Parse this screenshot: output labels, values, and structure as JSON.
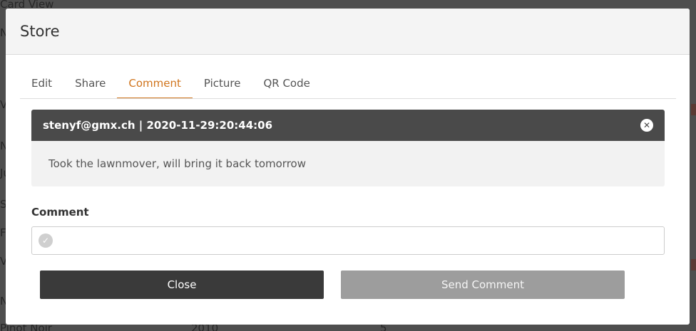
{
  "background": {
    "title": "Card View",
    "left_letters": [
      "N",
      "V",
      "N",
      "Ju",
      "S",
      "F",
      "V",
      "N"
    ],
    "bottom_row": [
      "Pinot Noir",
      "2010",
      "5"
    ]
  },
  "modal": {
    "title": "Store",
    "tabs": [
      {
        "label": "Edit",
        "active": false
      },
      {
        "label": "Share",
        "active": false
      },
      {
        "label": "Comment",
        "active": true
      },
      {
        "label": "Picture",
        "active": false
      },
      {
        "label": "QR Code",
        "active": false
      }
    ],
    "comments": [
      {
        "meta": "stenyf@gmx.ch | 2020-11-29:20:44:06",
        "text": "Took the lawnmover, will bring it back tomorrow",
        "close_icon": "close-icon"
      }
    ],
    "comment_field": {
      "label": "Comment",
      "value": "",
      "icon": "check-icon"
    },
    "buttons": {
      "close_label": "Close",
      "send_label": "Send Comment"
    }
  },
  "colors": {
    "accent": "#d0741c",
    "header_dark": "#4a4a4a",
    "close_button": "#3a3a3a",
    "send_button_disabled": "#9d9d9d"
  }
}
